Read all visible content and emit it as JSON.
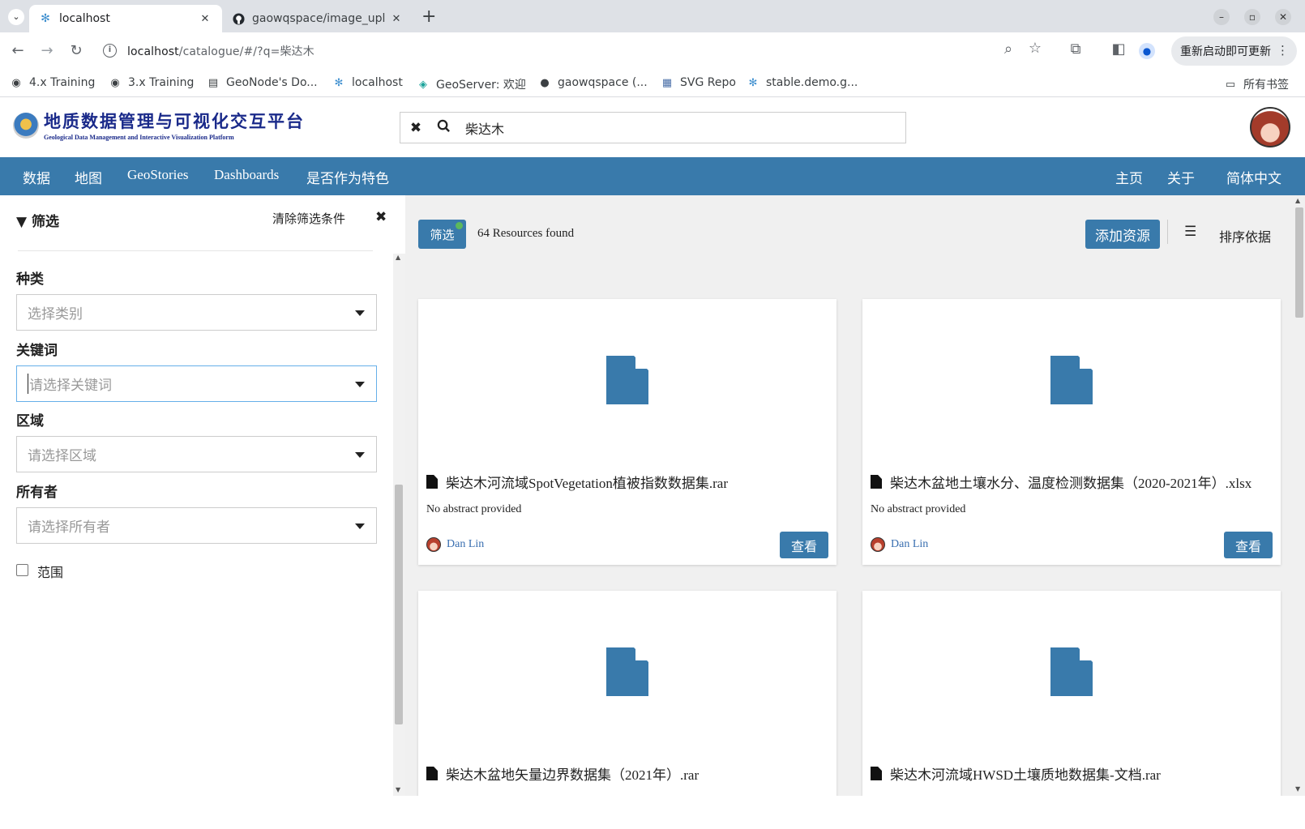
{
  "browser": {
    "tabs": [
      {
        "title": "localhost",
        "active": true,
        "icon": "geonode-icon"
      },
      {
        "title": "gaowqspace/image_upl",
        "active": false,
        "icon": "github-icon"
      }
    ],
    "new_tab": "+",
    "address": {
      "host": "localhost",
      "path": "/catalogue/#/?q=柴达木"
    },
    "update_button": "重新启动即可更新",
    "bookmarks": [
      {
        "label": "4.x Training",
        "icon": "globe-icon"
      },
      {
        "label": "3.x Training",
        "icon": "globe-icon"
      },
      {
        "label": "GeoNode's Do...",
        "icon": "doc-icon"
      },
      {
        "label": "localhost",
        "icon": "geonode-icon"
      },
      {
        "label": "GeoServer: 欢迎",
        "icon": "geoserver-icon"
      },
      {
        "label": "gaowqspace (...",
        "icon": "github-icon"
      },
      {
        "label": "SVG Repo",
        "icon": "svgrepo-icon"
      },
      {
        "label": "stable.demo.g...",
        "icon": "geonode-icon"
      }
    ],
    "all_bookmarks": "所有书签"
  },
  "site": {
    "logo_title": "地质数据管理与可视化交互平台",
    "logo_subtitle": "Geological Data Management and Interactive Visualization Platform",
    "search_value": "柴达木",
    "nav_left": [
      "数据",
      "地图",
      "GeoStories",
      "Dashboards",
      "是否作为特色"
    ],
    "nav_right": [
      "主页",
      "关于",
      "简体中文"
    ],
    "accent": "#397aab"
  },
  "filters": {
    "title": "筛选",
    "clear": "清除筛选条件",
    "category": {
      "label": "种类",
      "placeholder": "选择类别"
    },
    "keywords": {
      "label": "关键词",
      "placeholder": "请选择关键词"
    },
    "region": {
      "label": "区域",
      "placeholder": "请选择区域"
    },
    "owner": {
      "label": "所有者",
      "placeholder": "请选择所有者"
    },
    "extent": {
      "label": "范围",
      "checked": false
    }
  },
  "results": {
    "filter_button": "筛选",
    "count_text": "64 Resources found",
    "add_resource": "添加资源",
    "sort_by": "排序依据",
    "cards": [
      {
        "title": "柴达木河流域SpotVegetation植被指数数据集.rar",
        "abstract": "No abstract provided",
        "owner": "Dan Lin",
        "view": "查看"
      },
      {
        "title": "柴达木盆地土壤水分、温度检测数据集（2020-2021年）.xlsx",
        "abstract": "No abstract provided",
        "owner": "Dan Lin",
        "view": "查看"
      },
      {
        "title": "柴达木盆地矢量边界数据集（2021年）.rar",
        "abstract": "",
        "owner": "",
        "view": ""
      },
      {
        "title": "柴达木河流域HWSD土壤质地数据集-文档.rar",
        "abstract": "",
        "owner": "",
        "view": ""
      }
    ]
  }
}
